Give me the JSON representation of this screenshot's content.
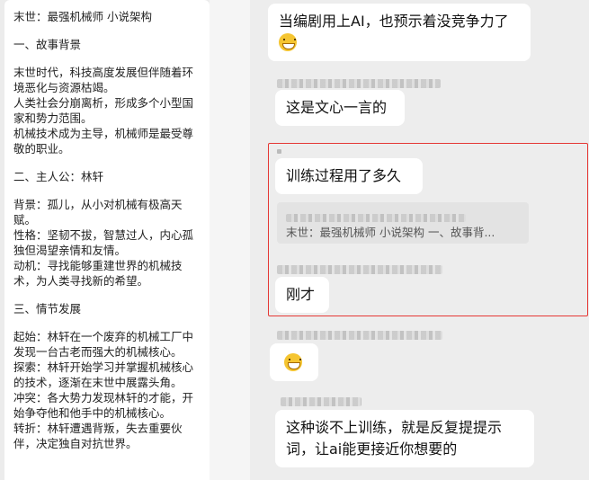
{
  "document": {
    "title": "末世：最强机械师 小说架构",
    "section1_heading": "一、故事背景",
    "section1_paragraphs": [
      "末世时代，科技高度发展但伴随着环境恶化与资源枯竭。",
      "人类社会分崩离析，形成多个小型国家和势力范围。",
      "机械技术成为主导，机械师是最受尊敬的职业。"
    ],
    "section2_heading": "二、主人公：林轩",
    "section2_paragraphs": [
      "背景：孤儿，从小对机械有极高天赋。",
      "性格：坚韧不拔，智慧过人，内心孤独但渴望亲情和友情。",
      "动机：寻找能够重建世界的机械技术，为人类寻找新的希望。"
    ],
    "section3_heading": "三、情节发展",
    "section3_paragraphs": [
      "起始：林轩在一个废弃的机械工厂中发现一台古老而强大的机械核心。",
      "探索：林轩开始学习并掌握机械核心的技术，逐渐在末世中展露头角。",
      "冲突：各大势力发现林轩的才能，开始争夺他和他手中的机械核心。",
      "转折：林轩遭遇背叛，失去重要伙伴，决定独自对抗世界。"
    ]
  },
  "chat": {
    "messages": [
      {
        "text": "当编剧用上AI，也预示着没竞争力了",
        "emoji": "grin-emoji"
      },
      {
        "text": "这是文心一言的"
      },
      {
        "text": "训练过程用了多久"
      },
      {
        "quote": "末世：最强机械师 小说架构  一、故事背..."
      },
      {
        "text": "刚才"
      },
      {
        "emoji": "laugh-emoji"
      },
      {
        "text": "这种谈不上训练，就是反复提提示词，让ai能更接近你想要的"
      }
    ],
    "highlight_color": "#e53935"
  }
}
